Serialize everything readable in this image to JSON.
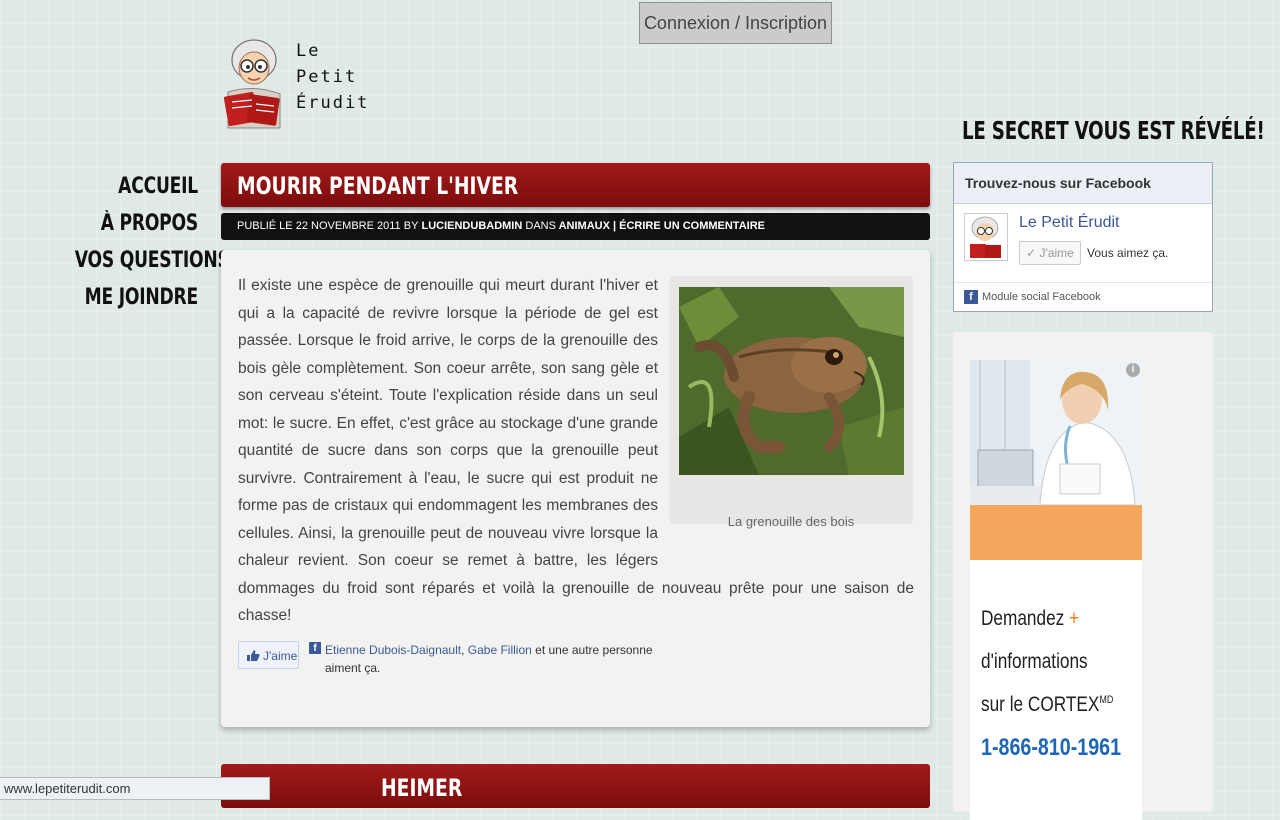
{
  "header": {
    "login_label": "Connexion / Inscription",
    "logo": {
      "line1": "Le",
      "line2": "Petit",
      "line3": "Érudit"
    }
  },
  "nav": {
    "items": [
      {
        "label": "ACCUEIL"
      },
      {
        "label": "À PROPOS"
      },
      {
        "label": "VOS QUESTIONS"
      },
      {
        "label": "ME JOINDRE"
      }
    ]
  },
  "post": {
    "title": "MOURIR PENDANT L'HIVER",
    "meta": {
      "published_prefix": "Publié le",
      "date": "22 novembre 2011",
      "by": "by",
      "author": "luciendubadmin",
      "in": "dans",
      "category": "Animaux",
      "separator": "|",
      "comment_link": "Écrire un commentaire"
    },
    "body_text": "Il existe une espèce de grenouille qui meurt durant l'hiver et qui a la capacité de revivre lorsque la période de gel est passée. Lorsque le froid arrive, le corps de la grenouille des bois gèle complètement. Son coeur arrête, son sang gèle et son cerveau s'éteint. Toute l'explication réside dans un seul mot: le sucre. En effet, c'est grâce au stockage d'une grande quantité de sucre dans son corps que la grenouille peut survivre. Contrairement à l'eau, le sucre qui est produit ne forme pas de cristaux qui endommagent les membranes des cellules. Ainsi, la grenouille peut de nouveau vivre lorsque la chaleur revient. Son coeur se remet à battre, les légers dommages du froid sont réparés et voilà la grenouille de nouveau prête pour une saison de chasse!",
    "image_caption": "La grenouille des bois",
    "like_button": "J'aime",
    "likers": {
      "name1": "Etienne Dubois-Daignault",
      "comma": ",",
      "name2": "Gabe Fillion",
      "rest": " et une autre personne aiment ça."
    }
  },
  "next_post": {
    "title_visible": "HEIMER"
  },
  "status_bar": {
    "url": "www.lepetiterudit.com"
  },
  "sidebar": {
    "heading": "LE SECRET VOUS EST RÉVÉLÉ!",
    "facebook": {
      "header": "Trouvez-nous sur Facebook",
      "page_name": "Le Petit Érudit",
      "like_button": "J'aime",
      "like_count_text": "Vous aimez ça.",
      "footer": "Module social Facebook"
    },
    "ad": {
      "line1_text": "Demandez ",
      "line1_plus": "+",
      "line2": "d'informations",
      "line3_text": "sur le CORTEX",
      "line3_sup": "MD",
      "phone": "1-866-810-1961",
      "info_icon": "i"
    }
  },
  "colors": {
    "title_bar": "#8f1111",
    "meta_bar": "#111111",
    "facebook_blue": "#3b5998",
    "ad_orange": "#f6a65c",
    "ad_phone": "#1e67b8"
  }
}
